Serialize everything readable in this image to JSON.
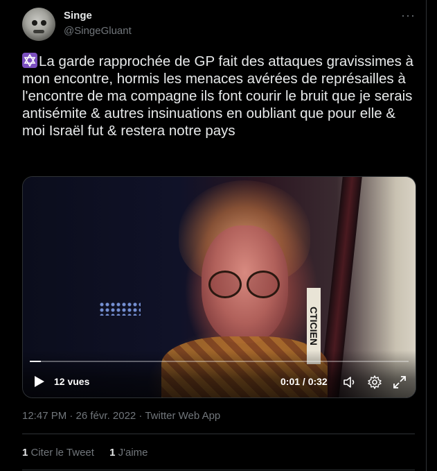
{
  "author": {
    "name": "Singe",
    "handle": "@SingeGluant"
  },
  "menu": {
    "more_label": "···"
  },
  "tweet": {
    "emoji": "star-of-david",
    "text": "La garde rapprochée de GP fait des attaques gravissimes à mon encontre, hormis les menaces avérées de représailles à l'encontre de ma compagne ils font courir le bruit que je serais antisémite & autres insinuations en oubliant que pour elle & moi Israël fut & restera notre pays"
  },
  "video": {
    "views": "12 vues",
    "time": "0:01 / 0:32",
    "progress": 0.03,
    "sign_text": "CTICIEN"
  },
  "meta": {
    "text": "12:47 PM · 26 févr. 2022 · Twitter Web App"
  },
  "stats": {
    "quotes_count": "1",
    "quotes_label": "Citer le Tweet",
    "likes_count": "1",
    "likes_label": "J'aime"
  },
  "colors": {
    "background": "#000000",
    "text": "#e7e9ea",
    "secondary": "#71767b",
    "border": "#2f3336"
  }
}
